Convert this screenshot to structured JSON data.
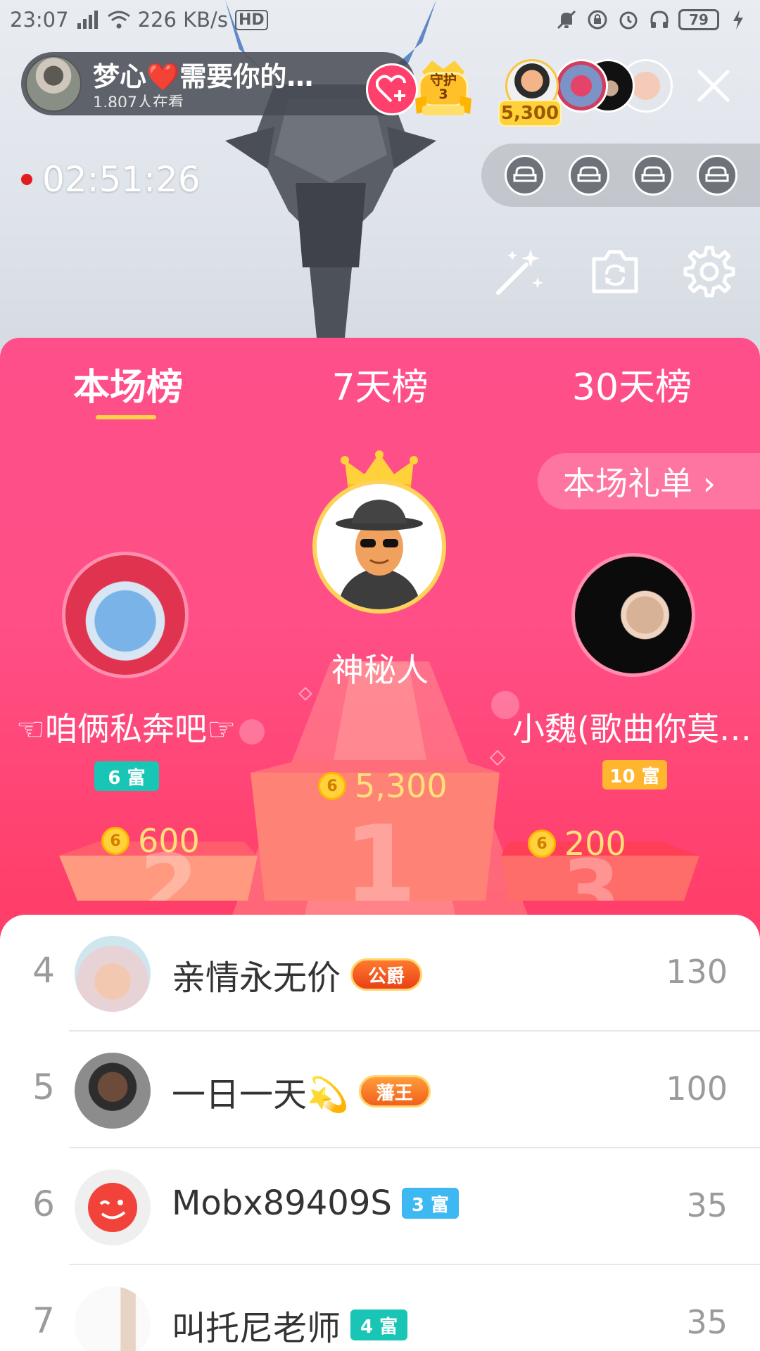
{
  "status_bar": {
    "time": "23:07",
    "network": "4G",
    "speed": "226 KB/s",
    "hd": "HD",
    "battery": "79"
  },
  "host": {
    "name": "梦心❤️需要你的…",
    "viewers": "1,807人在看",
    "guard_label": "守护",
    "guard_count": "3"
  },
  "top_viewers": {
    "gift_count": "5,300"
  },
  "timer": "02:51:26",
  "tabs": [
    {
      "label": "本场榜",
      "active": true
    },
    {
      "label": "7天榜",
      "active": false
    },
    {
      "label": "30天榜",
      "active": false
    }
  ],
  "gift_list_button": "本场礼单 ›",
  "podium": {
    "first": {
      "name": "神秘人",
      "score": "5,300"
    },
    "second": {
      "name": "☜咱俩私奔吧☞",
      "score": "600",
      "badge": "6 富"
    },
    "third": {
      "name": "小魏(歌曲你莫…",
      "score": "200",
      "badge": "10 富"
    },
    "coin_glyph": "6"
  },
  "list": [
    {
      "rank": "4",
      "name": "亲情永无价",
      "badge": "公爵",
      "badge_type": "duke",
      "score": "130"
    },
    {
      "rank": "5",
      "name": "一日一天💫",
      "badge": "藩王",
      "badge_type": "king",
      "score": "100"
    },
    {
      "rank": "6",
      "name": "Mobx89409S",
      "badge": "3 富",
      "badge_type": "rich",
      "badge_color": "#3db8f2",
      "score": "35"
    },
    {
      "rank": "7",
      "name": "叫托尼老师",
      "badge": "4 富",
      "badge_type": "rich",
      "badge_color": "#19c6b5",
      "score": "35"
    }
  ],
  "colors": {
    "panel_pink": "#ff4f86",
    "accent_gold": "#ffd04a",
    "follow_red": "#ff3f6c"
  }
}
